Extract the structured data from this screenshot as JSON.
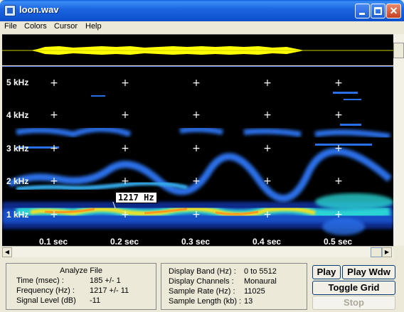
{
  "window": {
    "title": "loon.wav"
  },
  "menu": [
    "File",
    "Colors",
    "Cursor",
    "Help"
  ],
  "spectrogram": {
    "freq_labels": [
      "5 kHz",
      "4 kHz",
      "3 kHz",
      "2 kHz",
      "1 kHz"
    ],
    "time_labels": [
      "0.1 sec",
      "0.2 sec",
      "0.3 sec",
      "0.4 sec",
      "0.5 sec"
    ],
    "cursor_readout": "1217 Hz"
  },
  "analyze": {
    "title": "Analyze File",
    "rows": [
      {
        "label": "Time (msec) :",
        "value": "185  +/- 1"
      },
      {
        "label": "Frequency (Hz) :",
        "value": "1217 +/- 11"
      },
      {
        "label": "Signal Level (dB)",
        "value": "-11"
      }
    ]
  },
  "display": {
    "rows": [
      {
        "label": "Display Band (Hz) :",
        "value": "0 to 5512"
      },
      {
        "label": "Display Channels :",
        "value": "Monaural"
      },
      {
        "label": "Sample Rate (Hz) :",
        "value": "11025"
      },
      {
        "label": "Sample Length (kb) :",
        "value": "13"
      }
    ]
  },
  "buttons": {
    "play": "Play",
    "play_wdw": "Play Wdw",
    "toggle_grid": "Toggle Grid",
    "stop": "Stop"
  },
  "colors": {
    "title_bar": "#1b63e0",
    "spectrogram_bg": "#000000",
    "waveform": "#ffff00"
  }
}
